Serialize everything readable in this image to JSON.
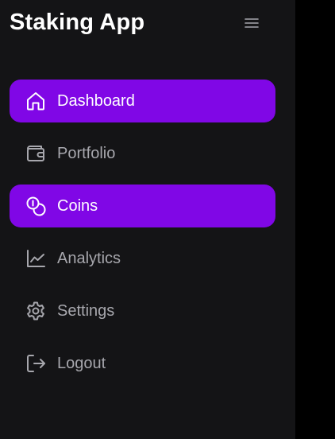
{
  "app": {
    "title": "Staking App",
    "menu_icon": "hamburger-menu-icon"
  },
  "colors": {
    "sidebar_bg": "#141416",
    "active_bg": "#8007e6",
    "active_text": "#ffffff",
    "inactive_text": "#a7a7ad",
    "page_bg": "#000000"
  },
  "nav": {
    "items": [
      {
        "label": "Dashboard",
        "icon": "home-icon",
        "active": true
      },
      {
        "label": "Portfolio",
        "icon": "wallet-icon",
        "active": false
      },
      {
        "label": "Coins",
        "icon": "coins-icon",
        "active": true
      },
      {
        "label": "Analytics",
        "icon": "line-chart-icon",
        "active": false
      },
      {
        "label": "Settings",
        "icon": "gear-icon",
        "active": false
      },
      {
        "label": "Logout",
        "icon": "logout-icon",
        "active": false
      }
    ]
  }
}
